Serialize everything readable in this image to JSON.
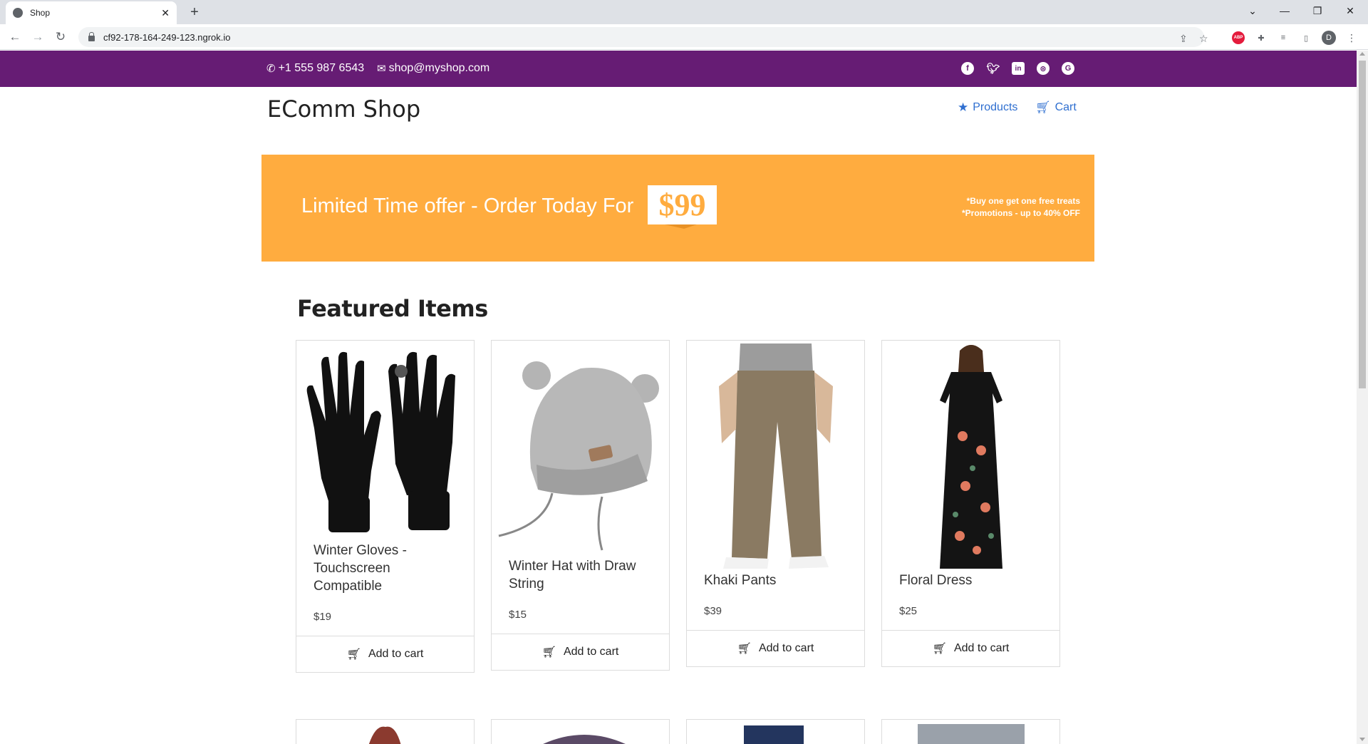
{
  "browser": {
    "tab_title": "Shop",
    "url": "cf92-178-164-249-123.ngrok.io",
    "profile_initial": "D",
    "abp_label": "ABP"
  },
  "topbar": {
    "phone": "+1 555 987 6543",
    "email": "shop@myshop.com",
    "social_icons": [
      "facebook-icon",
      "twitter-icon",
      "linkedin-icon",
      "dribbble-icon",
      "google-icon"
    ]
  },
  "header": {
    "brand": "EComm Shop",
    "nav": [
      {
        "label": "Products",
        "icon": "star-icon"
      },
      {
        "label": "Cart",
        "icon": "cart-icon"
      }
    ]
  },
  "banner": {
    "text": "Limited Time offer - Order Today For",
    "price": "$99",
    "note1": "*Buy one get one free treats",
    "note2": "*Promotions - up to 40% OFF"
  },
  "featured": {
    "title": "Featured Items",
    "add_label": "Add to cart",
    "items": [
      {
        "name": "Winter Gloves - Touchscreen Compatible",
        "price": "$19"
      },
      {
        "name": "Winter Hat with Draw String",
        "price": "$15"
      },
      {
        "name": "Khaki Pants",
        "price": "$39"
      },
      {
        "name": "Floral Dress",
        "price": "$25"
      }
    ]
  },
  "colors": {
    "topbar": "#661c74",
    "banner": "#ffac3f",
    "link": "#2f6fd0"
  }
}
